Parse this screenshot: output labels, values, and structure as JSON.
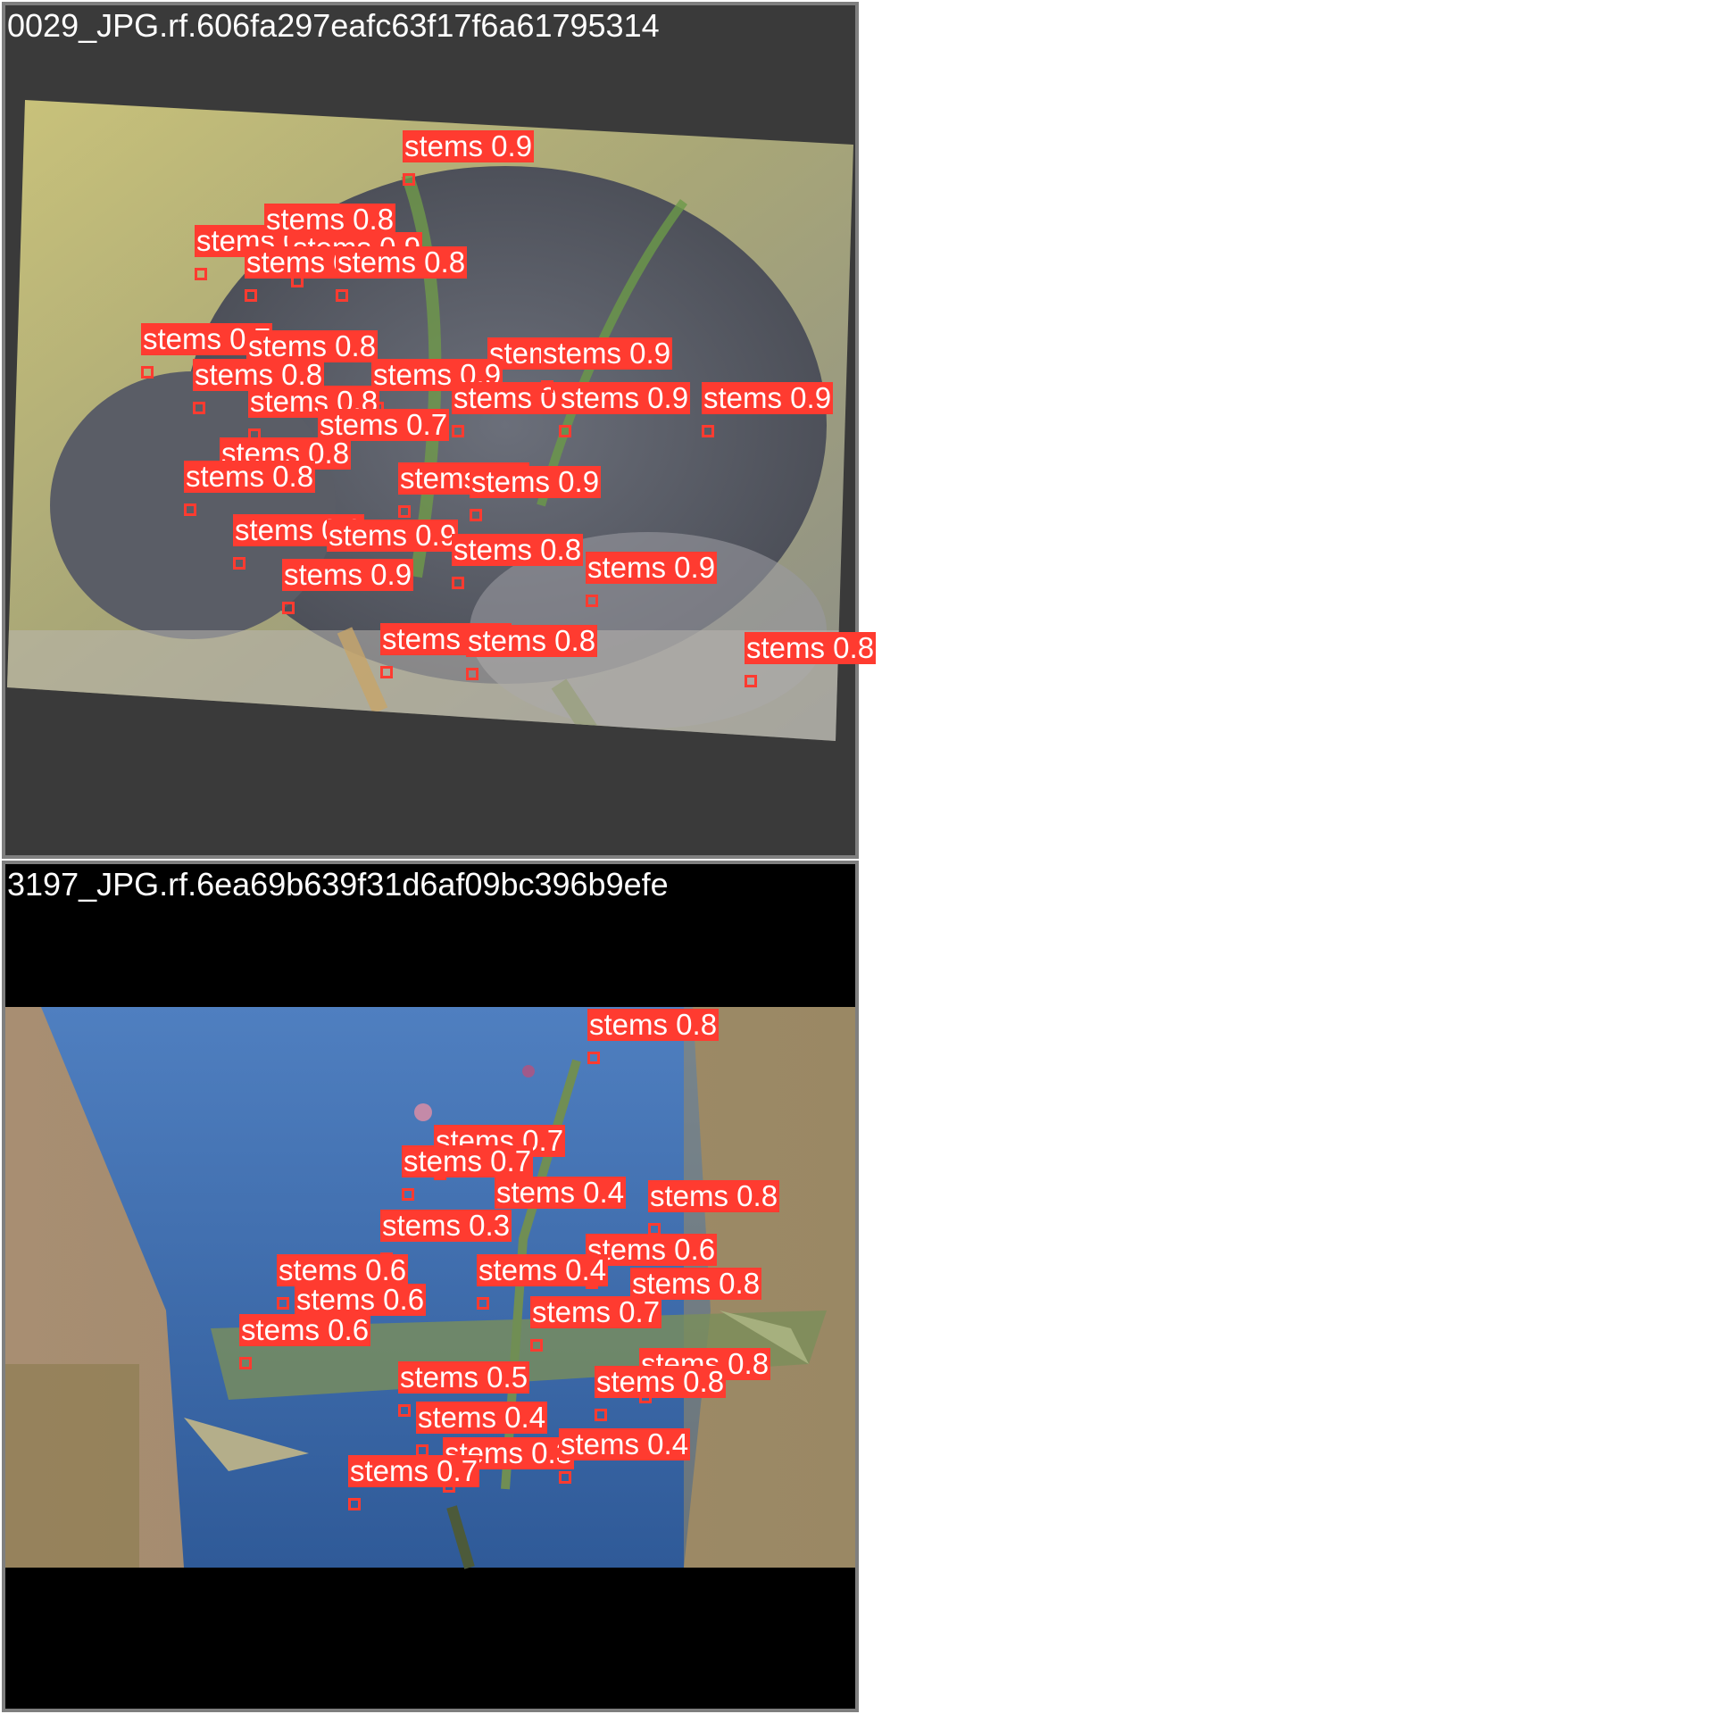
{
  "colors": {
    "label_bg": "#ff3b30",
    "label_text": "#ffffff",
    "panel_border": "#7f7f7f",
    "panel1_bg": "#3a3a3a",
    "panel2_bg": "#000000"
  },
  "panels": [
    {
      "title": "0029_JPG.rf.606fa297eafc63f17f6a61795314",
      "detections": [
        {
          "cls": "stems",
          "conf": "0.9"
        },
        {
          "cls": "stems",
          "conf": "0.8"
        },
        {
          "cls": "stems",
          "conf": "0.8"
        },
        {
          "cls": "stems",
          "conf": "0.9"
        },
        {
          "cls": "stems",
          "conf": "0.9"
        },
        {
          "cls": "stems",
          "conf": "0.8"
        },
        {
          "cls": "stems",
          "conf": "0.7"
        },
        {
          "cls": "stems",
          "conf": "0.8"
        },
        {
          "cls": "stems",
          "conf": "0.9"
        },
        {
          "cls": "stems",
          "conf": "0.8"
        },
        {
          "cls": "stems",
          "conf": "0.9"
        },
        {
          "cls": "stems",
          "conf": "0.8"
        },
        {
          "cls": "stems",
          "conf": "0.8"
        },
        {
          "cls": "stems",
          "conf": "0.9"
        },
        {
          "cls": "stems",
          "conf": "0.7"
        },
        {
          "cls": "stems",
          "conf": "0.9"
        },
        {
          "cls": "stems",
          "conf": "0.9"
        },
        {
          "cls": "stems",
          "conf": "0.8"
        },
        {
          "cls": "stems",
          "conf": "0.8"
        },
        {
          "cls": "stems",
          "conf": "0.8"
        },
        {
          "cls": "stems",
          "conf": "0.9"
        },
        {
          "cls": "stems",
          "conf": "0.8"
        },
        {
          "cls": "stems",
          "conf": "0.9"
        },
        {
          "cls": "stems",
          "conf": "0.8"
        },
        {
          "cls": "stems",
          "conf": "0.9"
        },
        {
          "cls": "stems",
          "conf": "0.9"
        },
        {
          "cls": "stems",
          "conf": "0.6"
        },
        {
          "cls": "stems",
          "conf": "0.8"
        },
        {
          "cls": "stems",
          "conf": "0.8"
        }
      ]
    },
    {
      "title": "3197_JPG.rf.6ea69b639f31d6af09bc396b9efe",
      "detections": [
        {
          "cls": "stems",
          "conf": "0.8"
        },
        {
          "cls": "stems",
          "conf": "0.7"
        },
        {
          "cls": "stems",
          "conf": "0.7"
        },
        {
          "cls": "stems",
          "conf": "0.4"
        },
        {
          "cls": "stems",
          "conf": "0.8"
        },
        {
          "cls": "stems",
          "conf": "0.3"
        },
        {
          "cls": "stems",
          "conf": "0.6"
        },
        {
          "cls": "stems",
          "conf": "0.6"
        },
        {
          "cls": "stems",
          "conf": "0.4"
        },
        {
          "cls": "stems",
          "conf": "0.8"
        },
        {
          "cls": "stems",
          "conf": "0.6"
        },
        {
          "cls": "stems",
          "conf": "0.7"
        },
        {
          "cls": "stems",
          "conf": "0.6"
        },
        {
          "cls": "stems",
          "conf": "0.8"
        },
        {
          "cls": "stems",
          "conf": "0.5"
        },
        {
          "cls": "stems",
          "conf": "0.8"
        },
        {
          "cls": "stems",
          "conf": "0.4"
        },
        {
          "cls": "stems",
          "conf": "0.3"
        },
        {
          "cls": "stems",
          "conf": "0.4"
        },
        {
          "cls": "stems",
          "conf": "0.7"
        }
      ]
    }
  ]
}
